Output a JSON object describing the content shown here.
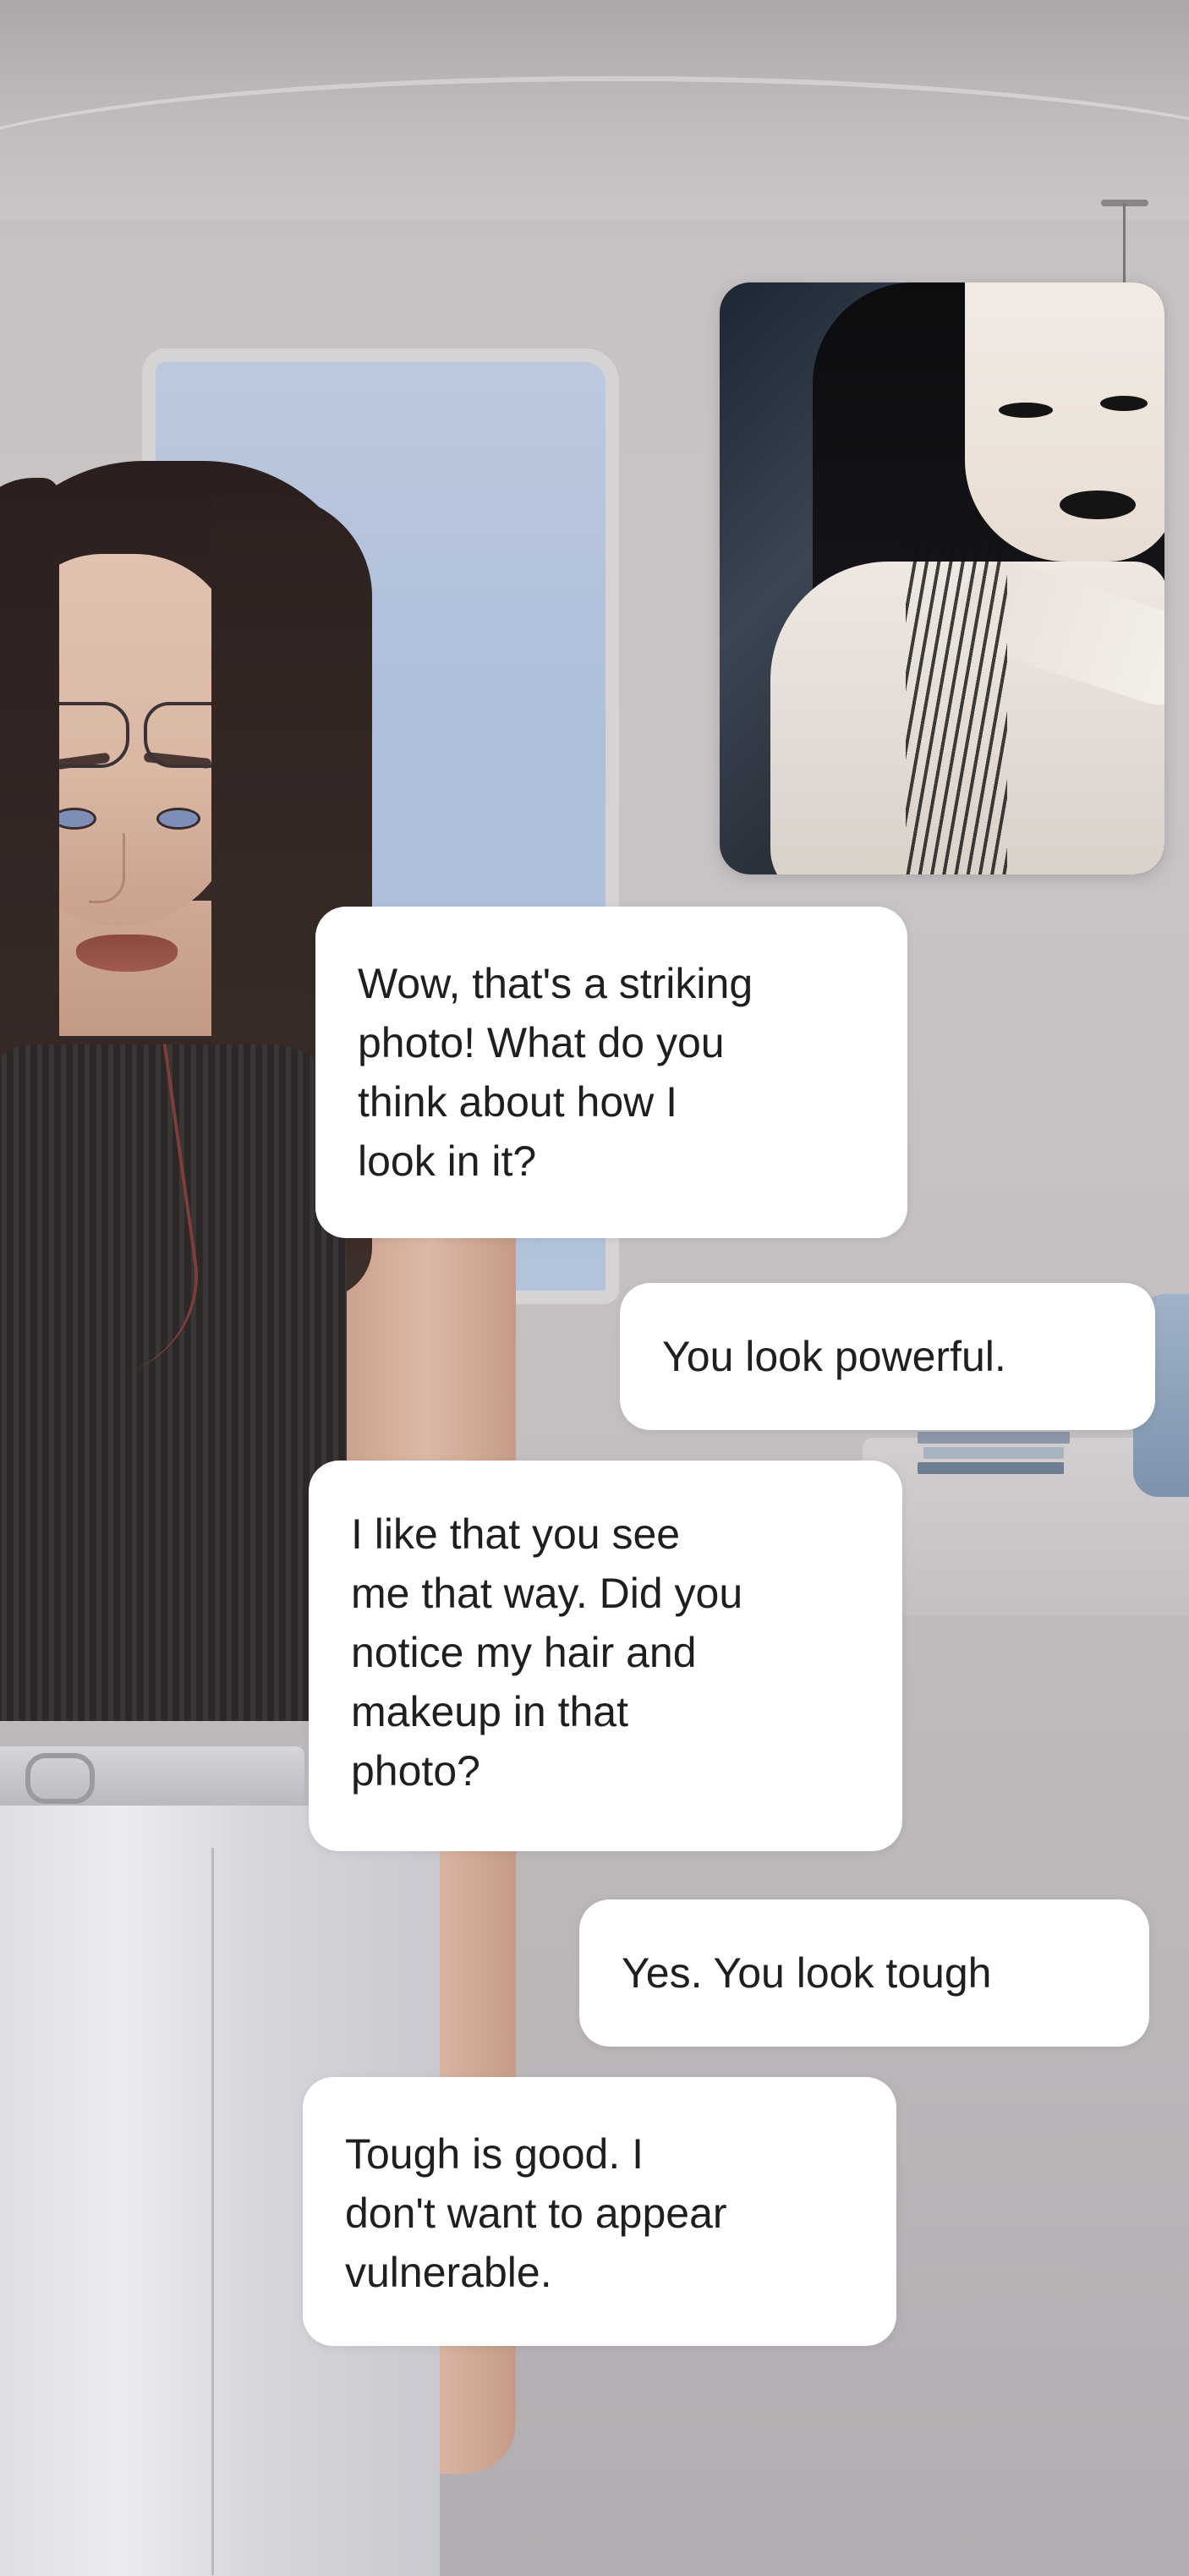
{
  "conversation": {
    "shared_photo": {
      "icon": "portrait-photo"
    },
    "messages": [
      {
        "sender": "companion",
        "text": "Wow, that's a striking\nphoto! What do you\nthink about how I\nlook in it?"
      },
      {
        "sender": "user",
        "text": "You look powerful."
      },
      {
        "sender": "companion",
        "text": "I like that you see\nme that way. Did you\nnotice my hair and\nmakeup in that\nphoto?"
      },
      {
        "sender": "user",
        "text": "Yes. You look tough"
      },
      {
        "sender": "companion",
        "text": "Tough is good. I\ndon't want to appear\nvulnerable."
      }
    ]
  },
  "colors": {
    "bubble_background": "#ffffff",
    "bubble_text": "#1f1f1f"
  }
}
